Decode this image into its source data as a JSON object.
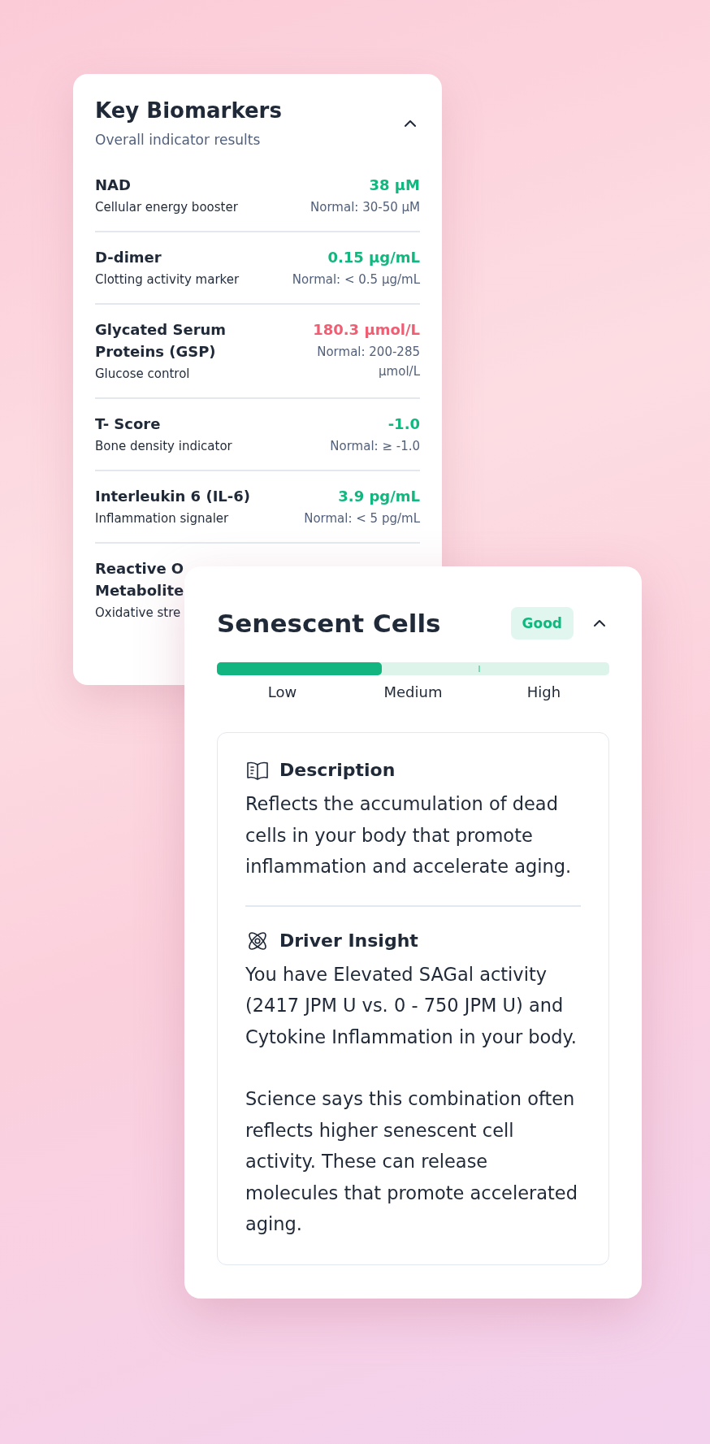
{
  "biomarkers_card": {
    "title": "Key Biomarkers",
    "subtitle": "Overall indicator results",
    "expanded": true,
    "rows": [
      {
        "name": "NAD",
        "description": "Cellular energy booster",
        "value": "38 µM",
        "color": "#10b77f",
        "range": "Normal: 30-50 µM"
      },
      {
        "name": "D-dimer",
        "description": "Clotting activity marker",
        "value": "0.15 µg/mL",
        "color": "#10b77f",
        "range": "Normal: < 0.5 µg/mL"
      },
      {
        "name": "Glycated Serum Proteins (GSP)",
        "description": "Glucose control",
        "value": "180.3 µmol/L",
        "color": "#ef5f74",
        "range": "Normal: 200-285 µmol/L"
      },
      {
        "name": "T- Score",
        "description": "Bone density indicator",
        "value": "-1.0",
        "color": "#10b77f",
        "range": "Normal: ≥ -1.0"
      },
      {
        "name": "Interleukin 6 (IL-6)",
        "description": "Inflammation signaler",
        "value": "3.9 pg/mL",
        "color": "#10b77f",
        "range": "Normal: < 5 pg/mL"
      },
      {
        "name": "Reactive O\nMetabolite",
        "description": "Oxidative stre"
      }
    ]
  },
  "detail_card": {
    "title": "Senescent Cells",
    "badge": "Good",
    "expanded": true,
    "level": 0.42,
    "scale_labels": [
      "Low",
      "Medium",
      "High"
    ],
    "sections": [
      {
        "kind": "description",
        "heading": "Description",
        "paragraphs": [
          "Reflects the accumulation of dead cells in your body that promote inflammation and accelerate aging."
        ]
      },
      {
        "kind": "insight",
        "heading": "Driver Insight",
        "paragraphs": [
          "You have Elevated SAGal activity (2417 JPM U vs. 0 - 750 JPM U) and Cytokine Inflammation in your body.",
          "Science says this combination often reflects higher senescent cell activity. These can release molecules that promote accelerated aging."
        ]
      }
    ]
  }
}
